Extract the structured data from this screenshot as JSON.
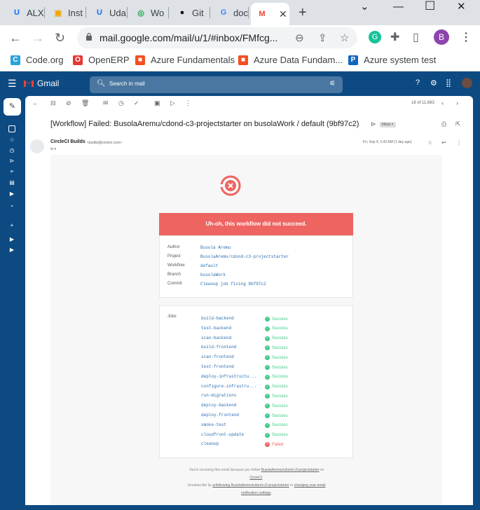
{
  "browser": {
    "tabs": [
      {
        "label": "ALX",
        "fav_color": "#0d6efd",
        "fav_glyph": "U"
      },
      {
        "label": "Inst",
        "fav_color": "#f0a500",
        "fav_glyph": "▣"
      },
      {
        "label": "Uda",
        "fav_color": "#0d6efd",
        "fav_glyph": "U"
      },
      {
        "label": "Wo",
        "fav_color": "#1ea446",
        "fav_glyph": "◎"
      },
      {
        "label": "Git",
        "fav_color": "#111111",
        "fav_glyph": "●"
      },
      {
        "label": "doc",
        "fav_color": "#4285f4",
        "fav_glyph": "G"
      },
      {
        "label": "",
        "fav_color": "#ea4335",
        "fav_glyph": "M",
        "active": true
      }
    ],
    "new_tab": "+",
    "window_controls": {
      "menu": "⌄",
      "minimize": "—",
      "maximize": "☐",
      "close": "✕"
    },
    "url": "mail.google.com/mail/u/1/#inbox/FMfcg...",
    "profile_initial": "B"
  },
  "bookmarks": [
    {
      "label": "Code.org",
      "color": "#2aa3d8",
      "glyph": "C"
    },
    {
      "label": "OpenERP",
      "color": "#e53935",
      "glyph": "O"
    },
    {
      "label": "Azure Fundamentals",
      "color": "#f25022",
      "glyph": "■"
    },
    {
      "label": "Azure Data Fundam...",
      "color": "#f25022",
      "glyph": "■"
    },
    {
      "label": "Azure system test",
      "color": "#1565c0",
      "glyph": "P"
    }
  ],
  "gmail": {
    "app_name": "Gmail",
    "search_placeholder": "Search in mail",
    "pagination": "18 of 11,683",
    "subject": "[Workflow] Failed: BusolaAremu/cdond-c3-projectstarter on busolaWork / default (9bf97c2)",
    "label_chip": "Inbox ×",
    "sender_name": "CircleCI Builds",
    "sender_email": "<builds@circleci.com>",
    "to": "to ▾",
    "date": "Fri, Sep 9, 1:42 AM (1 day ago)"
  },
  "email": {
    "banner": "Uh-oh, this workflow did not succeed.",
    "details": [
      {
        "label": "Author",
        "value": "Busola Aremu"
      },
      {
        "label": "Project",
        "value": "BusolaAremu/cdond-c3-projectstarter"
      },
      {
        "label": "Workflow",
        "value": "default"
      },
      {
        "label": "Branch",
        "value": "busolaWork"
      },
      {
        "label": "Commit",
        "value": "Cleanup job fixing 9bf97c2"
      }
    ],
    "jobs_label": "Jobs",
    "jobs": [
      {
        "name": "build-backend",
        "status": "Success"
      },
      {
        "name": "test-backend",
        "status": "Success"
      },
      {
        "name": "scan-backend",
        "status": "Success"
      },
      {
        "name": "build-frontend",
        "status": "Success"
      },
      {
        "name": "scan-frontend",
        "status": "Success"
      },
      {
        "name": "test-frontend",
        "status": "Success"
      },
      {
        "name": "deploy-infrastructu...",
        "status": "Success"
      },
      {
        "name": "configure-infrastru...",
        "status": "Success"
      },
      {
        "name": "run-migrations",
        "status": "Success"
      },
      {
        "name": "deploy-backend",
        "status": "Success"
      },
      {
        "name": "deploy-frontend",
        "status": "Success"
      },
      {
        "name": "smoke-test",
        "status": "Success"
      },
      {
        "name": "cloudfront-update",
        "status": "Success"
      },
      {
        "name": "cleanup",
        "status": "Failed"
      }
    ],
    "footer_line1_pre": "You're receiving this email because you follow ",
    "footer_line1_link": "BusolaAremu/cdond-c3-projectstarter",
    "footer_line1_post": " on ",
    "footer_line2_link": "CircleCI",
    "footer_line3_pre": "Unsubscribe by ",
    "footer_line3_link": "unfollowing BusolaAremu/cdond-c3-projectstarter",
    "footer_line3_mid": " or ",
    "footer_line3_link2": "changing your email",
    "footer_line4_link": "notification settings"
  }
}
